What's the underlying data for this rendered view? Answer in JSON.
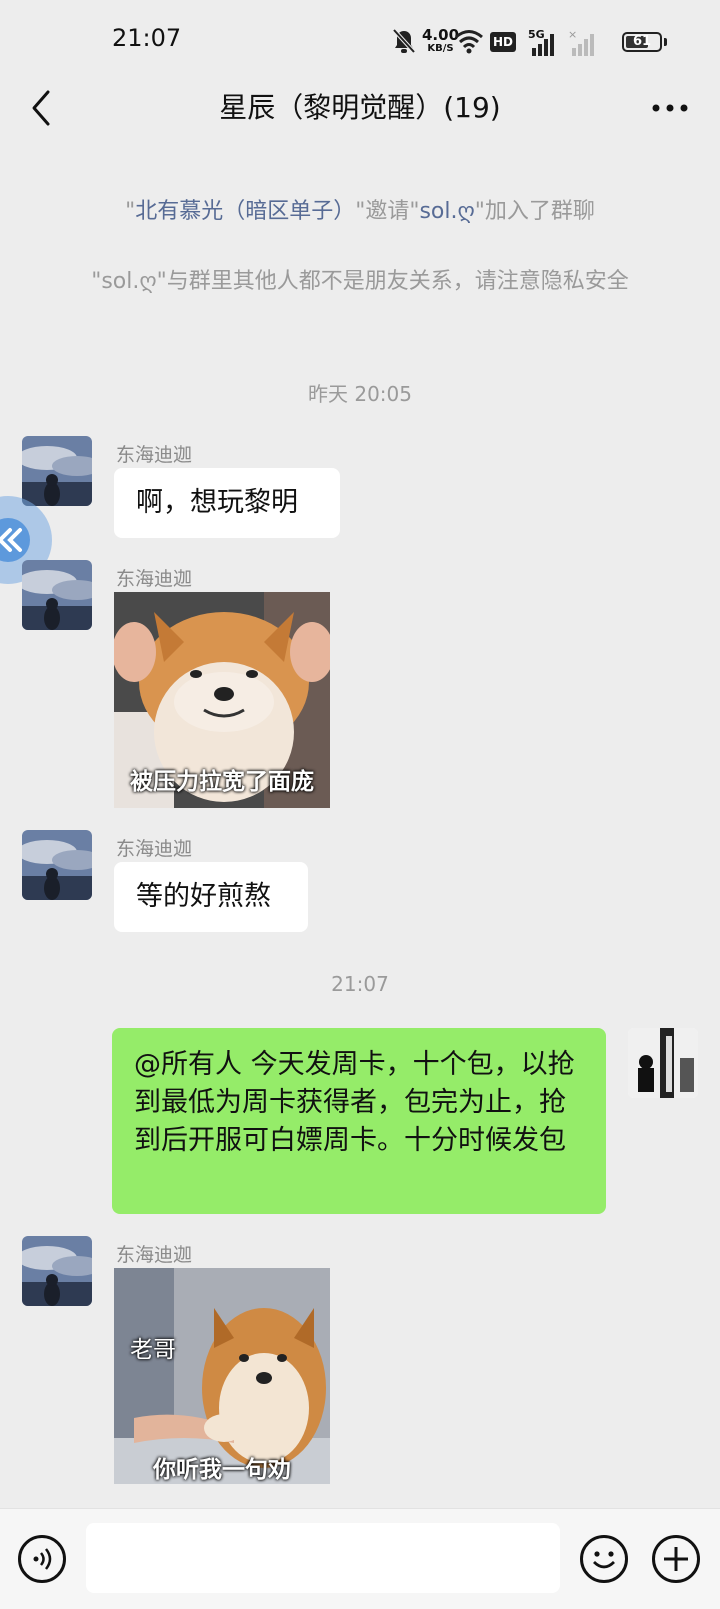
{
  "status_bar": {
    "time": "21:07",
    "net_speed_value": "4.00",
    "net_speed_unit": "KB/S",
    "hd_label": "HD",
    "network_label": "5G",
    "battery_level": "61",
    "icons": [
      "mute-icon",
      "wifi-icon",
      "hd-icon",
      "signal-5g-icon",
      "signal-icon",
      "battery-icon"
    ]
  },
  "nav": {
    "title": "星辰（黎明觉醒）(19)",
    "back_icon": "chevron-left-icon",
    "more_icon": "more-icon"
  },
  "system_messages": {
    "invite": {
      "q1": "\"",
      "inviter": "北有慕光（暗区单子）",
      "mid": "\"邀请\"",
      "invitee": "sol.ღ",
      "tail": "\"加入了群聊"
    },
    "privacy_notice": "\"sol.ღ\"与群里其他人都不是朋友关系，请注意隐私安全"
  },
  "timestamps": [
    "昨天 20:05",
    "21:07"
  ],
  "messages": [
    {
      "sender": "东海迪迦",
      "text": "啊，想玩黎明"
    },
    {
      "sender": "东海迪迦",
      "sticker_caption": "被压力拉宽了面庞"
    },
    {
      "sender": "东海迪迦",
      "text": "等的好煎熬"
    },
    {
      "sender": "",
      "text": "@所有人  今天发周卡，十个包，以抢到最低为周卡获得者，包完为止，抢到后开服可白嫖周卡。十分时候发包"
    },
    {
      "sender": "东海迪迦",
      "sticker_caption_top": "老哥",
      "sticker_caption_bottom": "你听我一句劝"
    }
  ],
  "input": {
    "placeholder": ""
  },
  "bottom_icons": [
    "voice-icon",
    "emoji-icon",
    "plus-icon"
  ],
  "colors": {
    "bubble_self": "#95ec69",
    "bubble_other": "#ffffff",
    "background": "#ededed",
    "link": "#576b95"
  }
}
